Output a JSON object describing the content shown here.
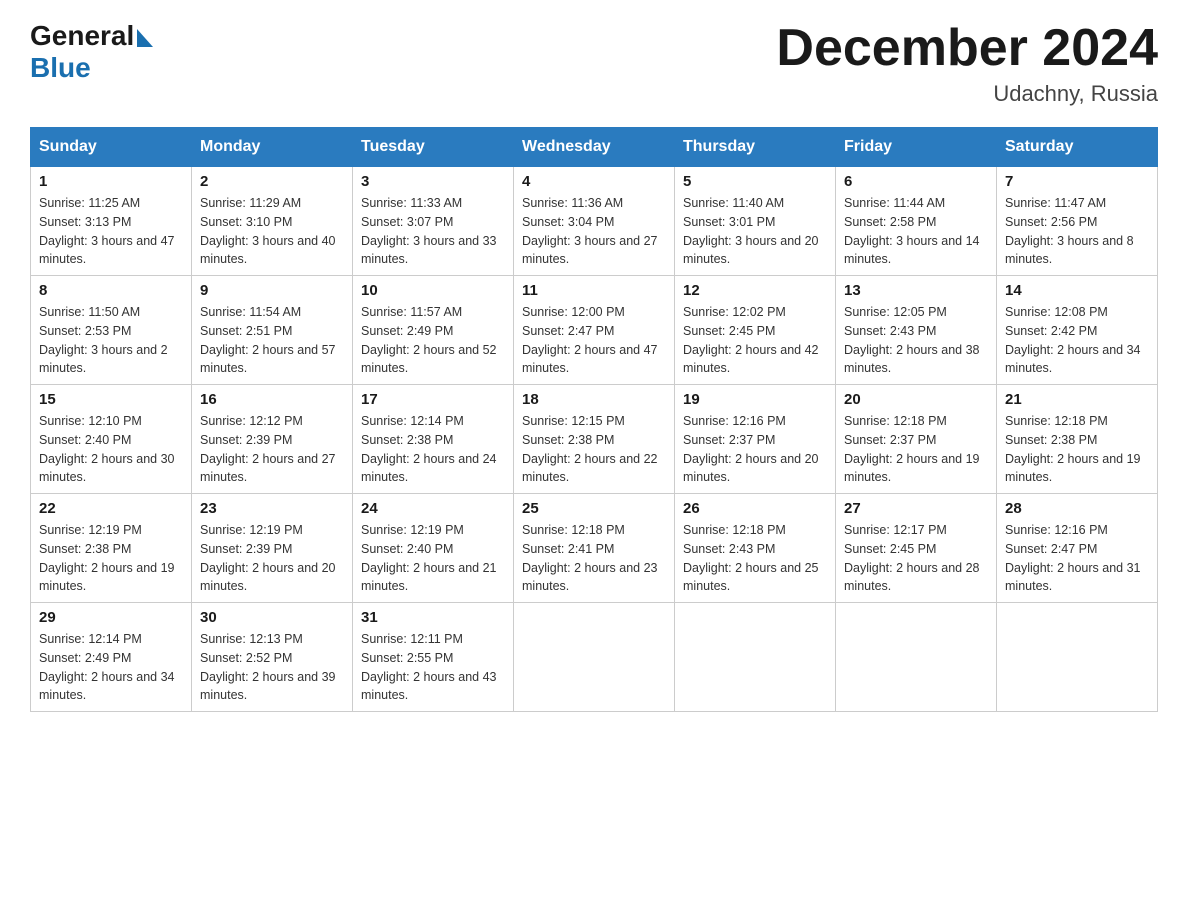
{
  "header": {
    "logo_general": "General",
    "logo_blue": "Blue",
    "month_title": "December 2024",
    "location": "Udachny, Russia"
  },
  "days_of_week": [
    "Sunday",
    "Monday",
    "Tuesday",
    "Wednesday",
    "Thursday",
    "Friday",
    "Saturday"
  ],
  "weeks": [
    [
      {
        "day": "1",
        "sunrise": "Sunrise: 11:25 AM",
        "sunset": "Sunset: 3:13 PM",
        "daylight": "Daylight: 3 hours and 47 minutes."
      },
      {
        "day": "2",
        "sunrise": "Sunrise: 11:29 AM",
        "sunset": "Sunset: 3:10 PM",
        "daylight": "Daylight: 3 hours and 40 minutes."
      },
      {
        "day": "3",
        "sunrise": "Sunrise: 11:33 AM",
        "sunset": "Sunset: 3:07 PM",
        "daylight": "Daylight: 3 hours and 33 minutes."
      },
      {
        "day": "4",
        "sunrise": "Sunrise: 11:36 AM",
        "sunset": "Sunset: 3:04 PM",
        "daylight": "Daylight: 3 hours and 27 minutes."
      },
      {
        "day": "5",
        "sunrise": "Sunrise: 11:40 AM",
        "sunset": "Sunset: 3:01 PM",
        "daylight": "Daylight: 3 hours and 20 minutes."
      },
      {
        "day": "6",
        "sunrise": "Sunrise: 11:44 AM",
        "sunset": "Sunset: 2:58 PM",
        "daylight": "Daylight: 3 hours and 14 minutes."
      },
      {
        "day": "7",
        "sunrise": "Sunrise: 11:47 AM",
        "sunset": "Sunset: 2:56 PM",
        "daylight": "Daylight: 3 hours and 8 minutes."
      }
    ],
    [
      {
        "day": "8",
        "sunrise": "Sunrise: 11:50 AM",
        "sunset": "Sunset: 2:53 PM",
        "daylight": "Daylight: 3 hours and 2 minutes."
      },
      {
        "day": "9",
        "sunrise": "Sunrise: 11:54 AM",
        "sunset": "Sunset: 2:51 PM",
        "daylight": "Daylight: 2 hours and 57 minutes."
      },
      {
        "day": "10",
        "sunrise": "Sunrise: 11:57 AM",
        "sunset": "Sunset: 2:49 PM",
        "daylight": "Daylight: 2 hours and 52 minutes."
      },
      {
        "day": "11",
        "sunrise": "Sunrise: 12:00 PM",
        "sunset": "Sunset: 2:47 PM",
        "daylight": "Daylight: 2 hours and 47 minutes."
      },
      {
        "day": "12",
        "sunrise": "Sunrise: 12:02 PM",
        "sunset": "Sunset: 2:45 PM",
        "daylight": "Daylight: 2 hours and 42 minutes."
      },
      {
        "day": "13",
        "sunrise": "Sunrise: 12:05 PM",
        "sunset": "Sunset: 2:43 PM",
        "daylight": "Daylight: 2 hours and 38 minutes."
      },
      {
        "day": "14",
        "sunrise": "Sunrise: 12:08 PM",
        "sunset": "Sunset: 2:42 PM",
        "daylight": "Daylight: 2 hours and 34 minutes."
      }
    ],
    [
      {
        "day": "15",
        "sunrise": "Sunrise: 12:10 PM",
        "sunset": "Sunset: 2:40 PM",
        "daylight": "Daylight: 2 hours and 30 minutes."
      },
      {
        "day": "16",
        "sunrise": "Sunrise: 12:12 PM",
        "sunset": "Sunset: 2:39 PM",
        "daylight": "Daylight: 2 hours and 27 minutes."
      },
      {
        "day": "17",
        "sunrise": "Sunrise: 12:14 PM",
        "sunset": "Sunset: 2:38 PM",
        "daylight": "Daylight: 2 hours and 24 minutes."
      },
      {
        "day": "18",
        "sunrise": "Sunrise: 12:15 PM",
        "sunset": "Sunset: 2:38 PM",
        "daylight": "Daylight: 2 hours and 22 minutes."
      },
      {
        "day": "19",
        "sunrise": "Sunrise: 12:16 PM",
        "sunset": "Sunset: 2:37 PM",
        "daylight": "Daylight: 2 hours and 20 minutes."
      },
      {
        "day": "20",
        "sunrise": "Sunrise: 12:18 PM",
        "sunset": "Sunset: 2:37 PM",
        "daylight": "Daylight: 2 hours and 19 minutes."
      },
      {
        "day": "21",
        "sunrise": "Sunrise: 12:18 PM",
        "sunset": "Sunset: 2:38 PM",
        "daylight": "Daylight: 2 hours and 19 minutes."
      }
    ],
    [
      {
        "day": "22",
        "sunrise": "Sunrise: 12:19 PM",
        "sunset": "Sunset: 2:38 PM",
        "daylight": "Daylight: 2 hours and 19 minutes."
      },
      {
        "day": "23",
        "sunrise": "Sunrise: 12:19 PM",
        "sunset": "Sunset: 2:39 PM",
        "daylight": "Daylight: 2 hours and 20 minutes."
      },
      {
        "day": "24",
        "sunrise": "Sunrise: 12:19 PM",
        "sunset": "Sunset: 2:40 PM",
        "daylight": "Daylight: 2 hours and 21 minutes."
      },
      {
        "day": "25",
        "sunrise": "Sunrise: 12:18 PM",
        "sunset": "Sunset: 2:41 PM",
        "daylight": "Daylight: 2 hours and 23 minutes."
      },
      {
        "day": "26",
        "sunrise": "Sunrise: 12:18 PM",
        "sunset": "Sunset: 2:43 PM",
        "daylight": "Daylight: 2 hours and 25 minutes."
      },
      {
        "day": "27",
        "sunrise": "Sunrise: 12:17 PM",
        "sunset": "Sunset: 2:45 PM",
        "daylight": "Daylight: 2 hours and 28 minutes."
      },
      {
        "day": "28",
        "sunrise": "Sunrise: 12:16 PM",
        "sunset": "Sunset: 2:47 PM",
        "daylight": "Daylight: 2 hours and 31 minutes."
      }
    ],
    [
      {
        "day": "29",
        "sunrise": "Sunrise: 12:14 PM",
        "sunset": "Sunset: 2:49 PM",
        "daylight": "Daylight: 2 hours and 34 minutes."
      },
      {
        "day": "30",
        "sunrise": "Sunrise: 12:13 PM",
        "sunset": "Sunset: 2:52 PM",
        "daylight": "Daylight: 2 hours and 39 minutes."
      },
      {
        "day": "31",
        "sunrise": "Sunrise: 12:11 PM",
        "sunset": "Sunset: 2:55 PM",
        "daylight": "Daylight: 2 hours and 43 minutes."
      },
      null,
      null,
      null,
      null
    ]
  ]
}
